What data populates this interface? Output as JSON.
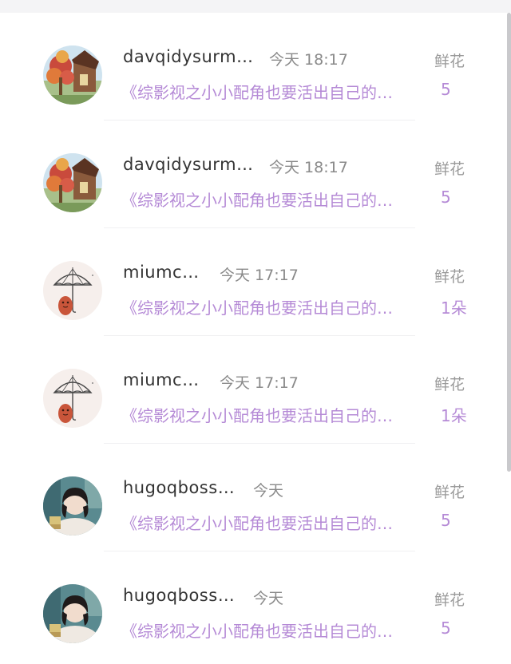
{
  "list": {
    "items": [
      {
        "username": "davqidysurm…",
        "time": "今天 18:17",
        "gift_type": "鲜花",
        "book": "《综影视之小小配角也要活出自己的…",
        "count": "5",
        "avatar": "tree-house-avatar-icon"
      },
      {
        "username": "davqidysurm…",
        "time": "今天 18:17",
        "gift_type": "鲜花",
        "book": "《综影视之小小配角也要活出自己的…",
        "count": "5",
        "avatar": "tree-house-avatar-icon"
      },
      {
        "username": "miumc…",
        "time": "今天 17:17",
        "gift_type": "鲜花",
        "book": "《综影视之小小配角也要活出自己的…",
        "count": "1朵",
        "avatar": "umbrella-avatar-icon"
      },
      {
        "username": "miumc…",
        "time": "今天 17:17",
        "gift_type": "鲜花",
        "book": "《综影视之小小配角也要活出自己的…",
        "count": "1朵",
        "avatar": "umbrella-avatar-icon"
      },
      {
        "username": "hugoqboss…",
        "time": "今天",
        "gift_type": "鲜花",
        "book": "《综影视之小小配角也要活出自己的…",
        "count": "5",
        "avatar": "girl-portrait-avatar-icon"
      },
      {
        "username": "hugoqboss…",
        "time": "今天",
        "gift_type": "鲜花",
        "book": "《综影视之小小配角也要活出自己的…",
        "count": "5",
        "avatar": "girl-portrait-avatar-icon"
      }
    ]
  },
  "colors": {
    "accent": "#b58ad6",
    "username": "#333333",
    "muted": "#8a8a8a",
    "background": "#ffffff",
    "page_background": "#f4f4f6"
  }
}
